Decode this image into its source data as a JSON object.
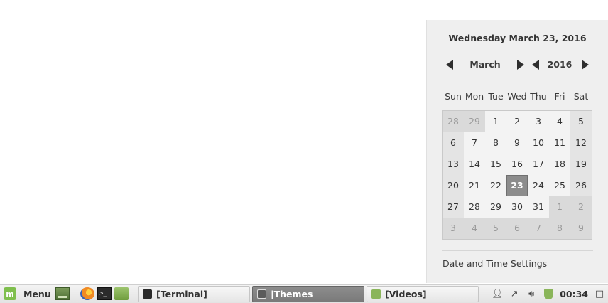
{
  "calendar": {
    "full_date": "Wednesday March 23, 2016",
    "month": "March",
    "year": "2016",
    "weekdays": [
      "Sun",
      "Mon",
      "Tue",
      "Wed",
      "Thu",
      "Fri",
      "Sat"
    ],
    "weeks": [
      [
        "28",
        "29",
        "1",
        "2",
        "3",
        "4",
        "5"
      ],
      [
        "6",
        "7",
        "8",
        "9",
        "10",
        "11",
        "12"
      ],
      [
        "13",
        "14",
        "15",
        "16",
        "17",
        "18",
        "19"
      ],
      [
        "20",
        "21",
        "22",
        "23",
        "24",
        "25",
        "26"
      ],
      [
        "27",
        "28",
        "29",
        "30",
        "31",
        "1",
        "2"
      ],
      [
        "3",
        "4",
        "5",
        "6",
        "7",
        "8",
        "9"
      ]
    ],
    "today": "23",
    "settings_label": "Date and Time Settings"
  },
  "taskbar": {
    "menu_label": "Menu",
    "tasks": [
      {
        "label": "[Terminal]",
        "icon": "terminal-icon",
        "active": false
      },
      {
        "label": "|Themes",
        "icon": "themes-icon",
        "active": true
      },
      {
        "label": "[Videos]",
        "icon": "folder-icon",
        "active": false
      }
    ],
    "clock": "00:34"
  }
}
